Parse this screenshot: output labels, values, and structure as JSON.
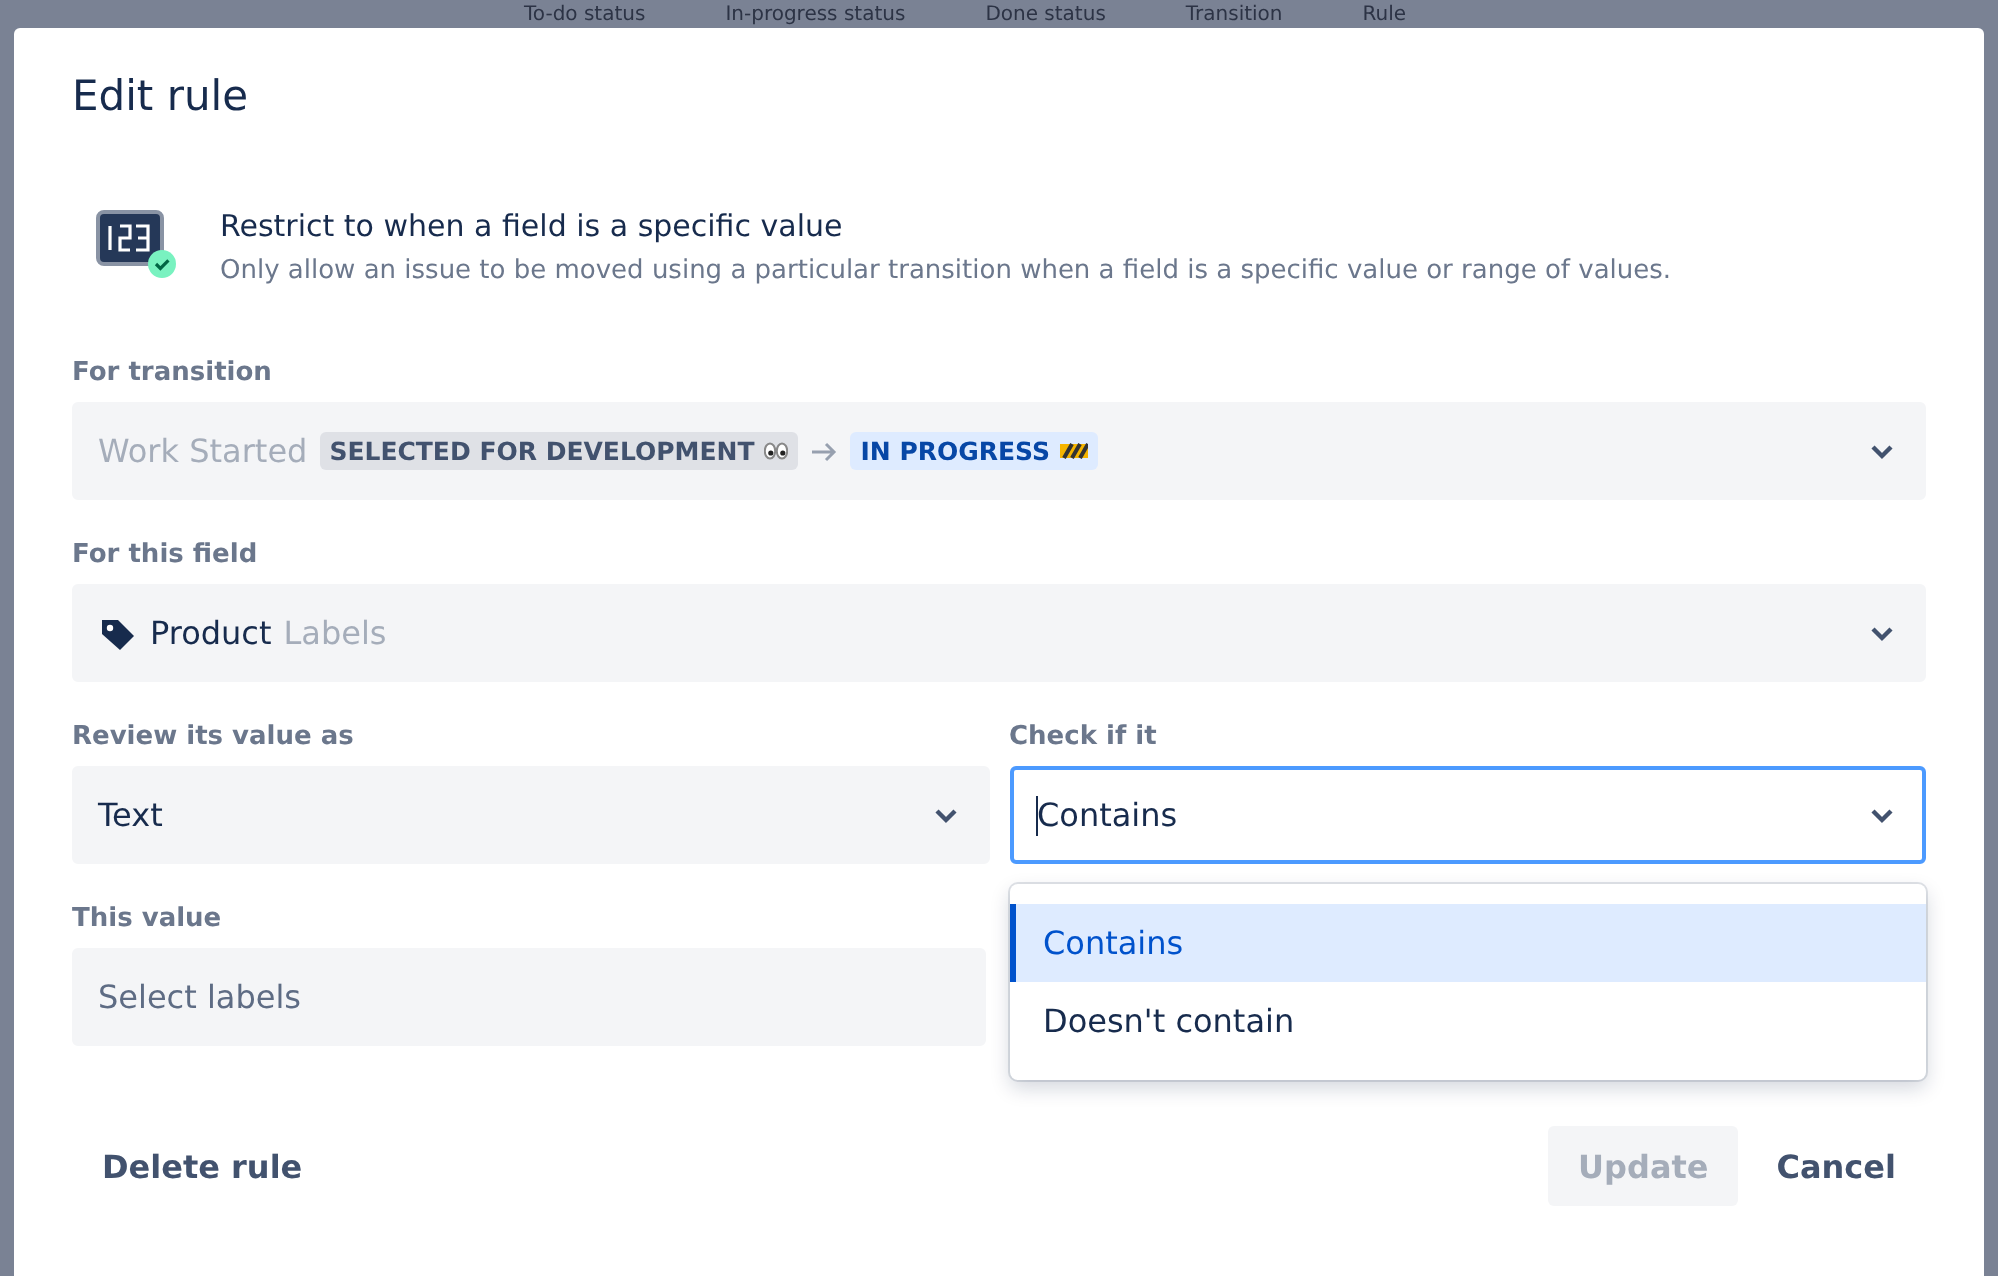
{
  "background": {
    "columns": [
      "To-do status",
      "In-progress status",
      "Done status",
      "Transition",
      "Rule"
    ]
  },
  "dialog": {
    "title": "Edit rule",
    "rule": {
      "title": "Restrict to when a field is a specific value",
      "description": "Only allow an issue to be moved using a particular transition when a field is a specific value or range of values."
    },
    "transition": {
      "label": "For transition",
      "disabled": true,
      "name": "Work Started",
      "from": "SELECTED FOR DEVELOPMENT",
      "to": "IN PROGRESS"
    },
    "field": {
      "label": "For this field",
      "value": "Product",
      "type": "Labels"
    },
    "review": {
      "label": "Review its value as",
      "value": "Text",
      "focused": false
    },
    "check": {
      "label": "Check if it",
      "value": "Contains",
      "focused": true,
      "options": [
        {
          "label": "Contains",
          "selected": true
        },
        {
          "label": "Doesn't contain",
          "selected": false
        }
      ]
    },
    "this_value": {
      "label": "This value",
      "placeholder": "Select labels"
    },
    "delete_button": "Delete rule",
    "update_button": {
      "label": "Update",
      "disabled": true
    },
    "cancel_button": "Cancel"
  }
}
